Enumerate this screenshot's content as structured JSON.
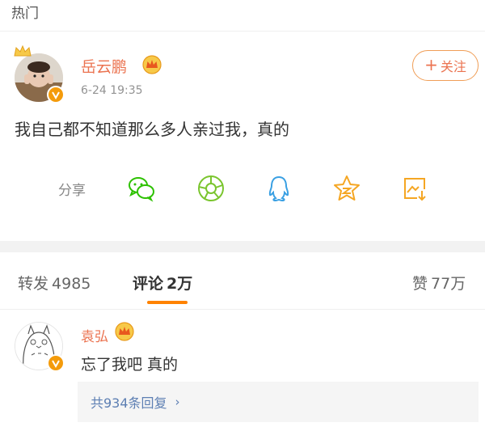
{
  "section": {
    "label": "热门"
  },
  "post": {
    "username": "岳云鹏",
    "timestamp": "6-24 19:35",
    "follow_label": "关注",
    "follow_plus": "+",
    "text": "我自己都不知道那么多人亲过我，真的"
  },
  "share": {
    "label": "分享",
    "icons": [
      "wechat-icon",
      "moments-icon",
      "qq-icon",
      "qzone-star-icon",
      "save-image-icon"
    ]
  },
  "tabs": {
    "repost": {
      "label": "转发",
      "count": "4985"
    },
    "comment": {
      "label": "评论",
      "count": "2万"
    },
    "like": {
      "label": "赞",
      "count": "77万"
    }
  },
  "comment": {
    "username": "袁弘",
    "text": "忘了我吧 真的",
    "replies_label": "共934条回复",
    "replies_chevron": "›"
  },
  "colors": {
    "accent": "#ff8200",
    "username": "#eb7350",
    "link": "#5d7fb3",
    "wechat": "#2dc100",
    "moments": "#7ac52e",
    "qq": "#3aa0e3",
    "star": "#f5a623",
    "save": "#f5a623"
  }
}
